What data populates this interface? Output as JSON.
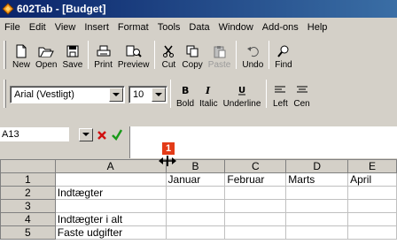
{
  "window": {
    "title": "602Tab - [Budget]"
  },
  "menu": [
    "File",
    "Edit",
    "View",
    "Insert",
    "Format",
    "Tools",
    "Data",
    "Window",
    "Add-ons",
    "Help"
  ],
  "toolbar_main": {
    "new": "New",
    "open": "Open",
    "save": "Save",
    "print": "Print",
    "preview": "Preview",
    "cut": "Cut",
    "copy": "Copy",
    "paste": "Paste",
    "undo": "Undo",
    "find": "Find"
  },
  "toolbar_format": {
    "font": "Arial (Vestligt)",
    "size": "10",
    "bold": "Bold",
    "italic": "Italic",
    "underline": "Underline",
    "left": "Left",
    "center": "Cen"
  },
  "formula": {
    "cell_ref": "A13",
    "value": ""
  },
  "callout": "1",
  "sheet": {
    "columns": [
      "A",
      "B",
      "C",
      "D",
      "E"
    ],
    "rows": [
      {
        "n": "1",
        "cells": [
          "",
          "Januar",
          "Februar",
          "Marts",
          "April"
        ]
      },
      {
        "n": "2",
        "cells": [
          "Indtægter",
          "",
          "",
          "",
          ""
        ]
      },
      {
        "n": "3",
        "cells": [
          "",
          "",
          "",
          "",
          ""
        ]
      },
      {
        "n": "4",
        "cells": [
          "Indtægter i alt",
          "",
          "",
          "",
          ""
        ]
      },
      {
        "n": "5",
        "cells": [
          "Faste udgifter",
          "",
          "",
          "",
          ""
        ]
      }
    ]
  }
}
